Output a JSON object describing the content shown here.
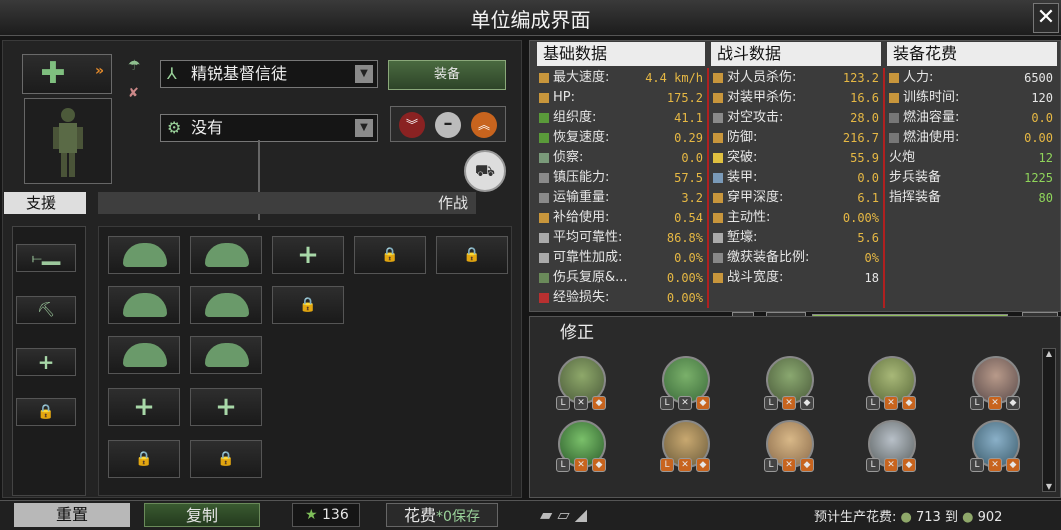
{
  "window": {
    "title": "单位编成界面",
    "close_label": "✕"
  },
  "division": {
    "template_name": "精锐基督信徒",
    "template_dropdown_arrow": "▼",
    "equip_button": "装备",
    "second_dropdown": "没有",
    "support_label": "支援",
    "combat_label": "作战"
  },
  "stats": {
    "base_header": "基础数据",
    "combat_header": "战斗数据",
    "cost_header": "装备花费",
    "base": [
      {
        "label": "最大速度:",
        "value": "4.4 km/h"
      },
      {
        "label": "HP:",
        "value": "175.2"
      },
      {
        "label": "组织度:",
        "value": "41.1"
      },
      {
        "label": "恢复速度:",
        "value": "0.29"
      },
      {
        "label": "侦察:",
        "value": "0.0"
      },
      {
        "label": "镇压能力:",
        "value": "57.5"
      },
      {
        "label": "运输重量:",
        "value": "3.2"
      },
      {
        "label": "补给使用:",
        "value": "0.54"
      },
      {
        "label": "平均可靠性:",
        "value": "86.8%"
      },
      {
        "label": "可靠性加成:",
        "value": "0.0%"
      },
      {
        "label": "伤兵复原&...",
        "value": "0.00%"
      },
      {
        "label": "经验损失:",
        "value": "0.00%"
      }
    ],
    "combat": [
      {
        "label": "对人员杀伤:",
        "value": "123.2"
      },
      {
        "label": "对装甲杀伤:",
        "value": "16.6"
      },
      {
        "label": "对空攻击:",
        "value": "28.0"
      },
      {
        "label": "防御:",
        "value": "216.7"
      },
      {
        "label": "突破:",
        "value": "55.9"
      },
      {
        "label": "装甲:",
        "value": "0.0"
      },
      {
        "label": "穿甲深度:",
        "value": "6.1"
      },
      {
        "label": "主动性:",
        "value": "0.00%"
      },
      {
        "label": "堑壕:",
        "value": "5.6"
      },
      {
        "label": "缴获装备比例:",
        "value": "0%"
      },
      {
        "label": "战斗宽度:",
        "value": "18"
      }
    ],
    "cost": [
      {
        "label": "人力:",
        "value": "6500"
      },
      {
        "label": "训练时间:",
        "value": "120"
      },
      {
        "label": "燃油容量:",
        "value": "0.0"
      },
      {
        "label": "燃油使用:",
        "value": "0.00"
      },
      {
        "label": "火炮",
        "value": "12"
      },
      {
        "label": "步兵装备",
        "value": "1225"
      },
      {
        "label": "指挥装备",
        "value": "80"
      }
    ]
  },
  "modifiers": {
    "title": "修正"
  },
  "bottom": {
    "reset": "重置",
    "copy": "复制",
    "xp_value": "136",
    "save": "花费",
    "save_tail": "*0保存",
    "estimate_label": "预计生产花费:",
    "estimate_min": "713",
    "estimate_to": "到",
    "estimate_max": "902"
  }
}
